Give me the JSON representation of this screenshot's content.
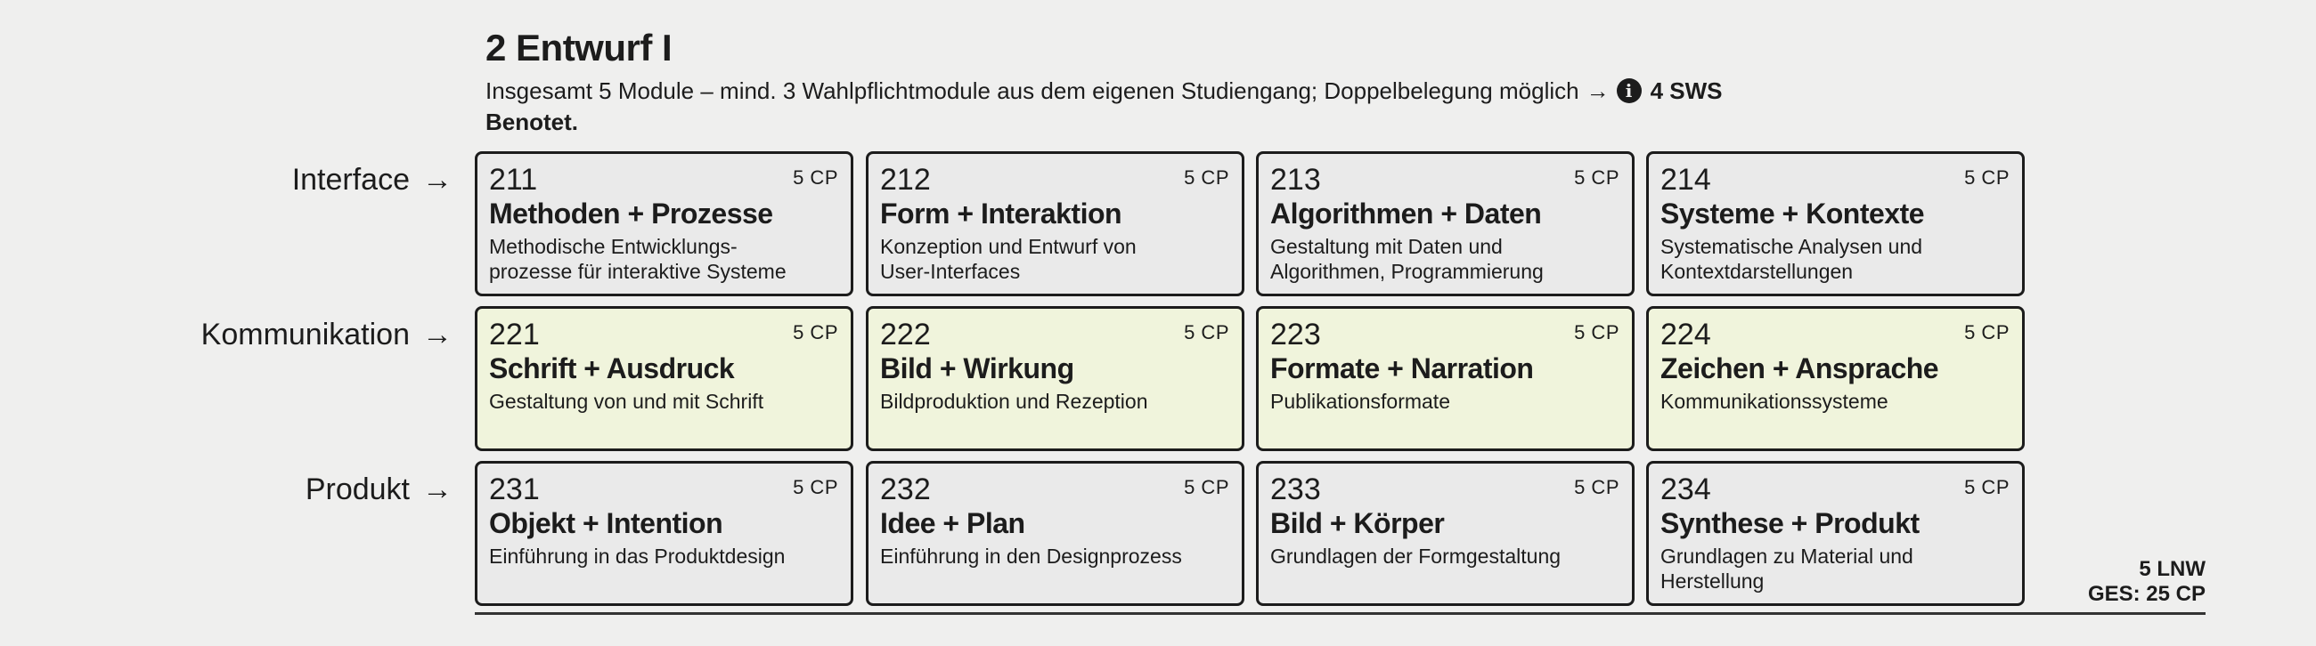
{
  "header": {
    "title": "2 Entwurf I",
    "subtitle": "Insgesamt 5 Module – mind. 3 Wahlpflichtmodule aus dem eigenen Studiengang; Doppelbelegung möglich",
    "arrow": "→",
    "info_icon": "info-icon",
    "info_glyph": "i",
    "sws": "4 SWS",
    "graded": "Benotet."
  },
  "rows": [
    {
      "label": "Interface",
      "arrow": "→",
      "color": "#eaeaea"
    },
    {
      "label": "Kommunikation",
      "arrow": "→",
      "color": "#f0f4dc"
    },
    {
      "label": "Produkt",
      "arrow": "→",
      "color": "#eaeaea"
    }
  ],
  "modules": [
    [
      {
        "num": "211",
        "cp": "5 CP",
        "name": "Methoden + Prozesse",
        "desc": "Methodische Entwicklungs-\nprozesse für interaktive Systeme"
      },
      {
        "num": "212",
        "cp": "5 CP",
        "name": "Form + Interaktion",
        "desc": "Konzeption und Entwurf von\nUser-Interfaces"
      },
      {
        "num": "213",
        "cp": "5 CP",
        "name": "Algorithmen + Daten",
        "desc": "Gestaltung mit Daten und\nAlgorithmen, Programmierung"
      },
      {
        "num": "214",
        "cp": "5 CP",
        "name": "Systeme + Kontexte",
        "desc": "Systematische Analysen und\nKontextdarstellungen"
      }
    ],
    [
      {
        "num": "221",
        "cp": "5 CP",
        "name": "Schrift + Ausdruck",
        "desc": "Gestaltung von und mit Schrift"
      },
      {
        "num": "222",
        "cp": "5 CP",
        "name": "Bild + Wirkung",
        "desc": "Bildproduktion und Rezeption"
      },
      {
        "num": "223",
        "cp": "5 CP",
        "name": "Formate + Narration",
        "desc": "Publikationsformate"
      },
      {
        "num": "224",
        "cp": "5 CP",
        "name": "Zeichen + Ansprache",
        "desc": "Kommunikationssysteme"
      }
    ],
    [
      {
        "num": "231",
        "cp": "5 CP",
        "name": "Objekt + Intention",
        "desc": "Einführung in das Produktdesign"
      },
      {
        "num": "232",
        "cp": "5 CP",
        "name": "Idee + Plan",
        "desc": "Einführung in den Designprozess"
      },
      {
        "num": "233",
        "cp": "5 CP",
        "name": "Bild + Körper",
        "desc": "Grundlagen der Formgestaltung"
      },
      {
        "num": "234",
        "cp": "5 CP",
        "name": "Synthese + Produkt",
        "desc": "Grundlagen zu Material und\nHerstellung"
      }
    ]
  ],
  "summary": {
    "lnw": "5 LNW",
    "total": "GES: 25 CP"
  }
}
